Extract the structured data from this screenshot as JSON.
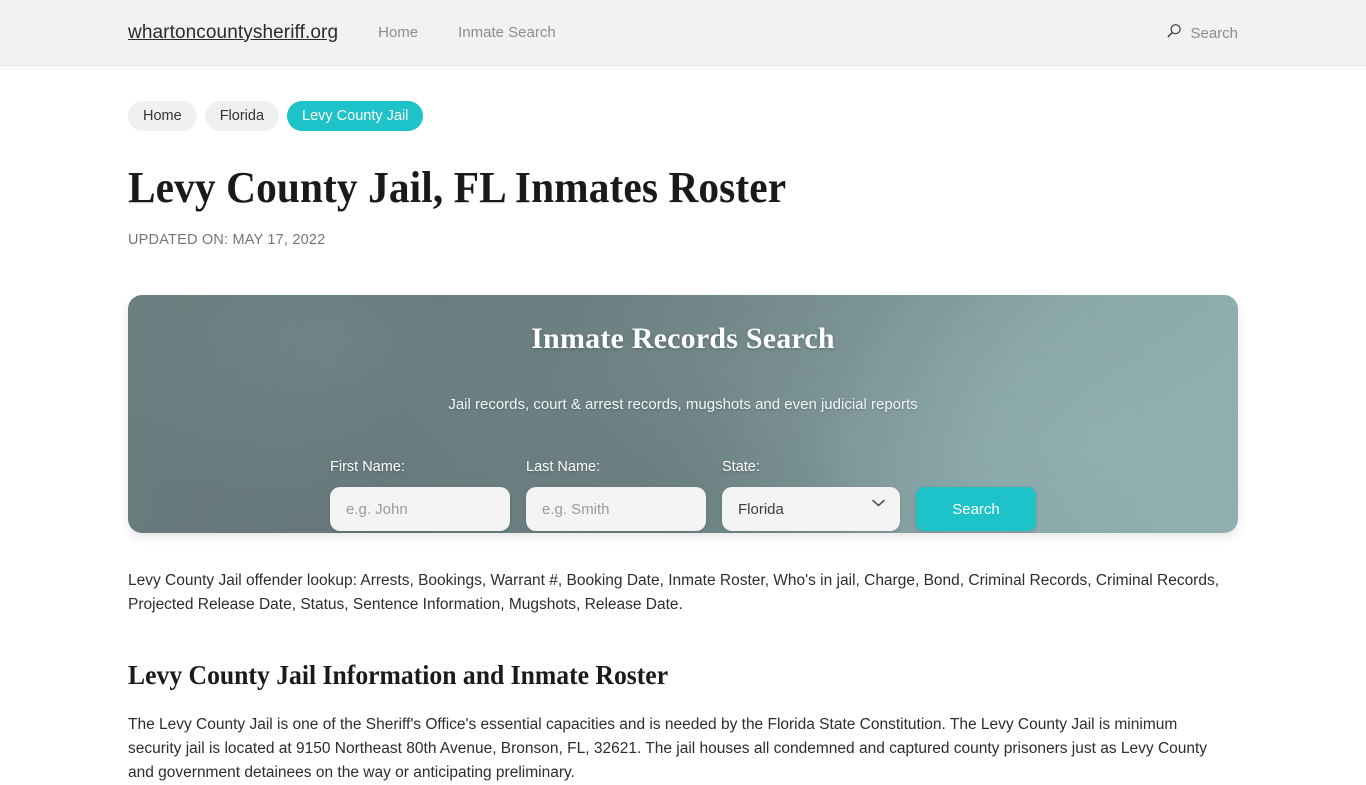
{
  "header": {
    "brand": "whartoncountysheriff.org",
    "nav": [
      {
        "label": "Home"
      },
      {
        "label": "Inmate Search"
      }
    ],
    "search_label": "Search"
  },
  "breadcrumb": {
    "items": [
      {
        "label": "Home",
        "active": false
      },
      {
        "label": "Florida",
        "active": false
      },
      {
        "label": "Levy County Jail",
        "active": true
      }
    ]
  },
  "main": {
    "title": "Levy County Jail, FL Inmates Roster",
    "updated_on": "UPDATED ON: MAY 17, 2022",
    "lede": "Levy County Jail offender lookup: Arrests, Bookings, Warrant #, Booking Date, Inmate Roster, Who's in jail, Charge, Bond, Criminal Records, Criminal Records, Projected Release Date, Status, Sentence Information, Mugshots, Release Date.",
    "section_heading": "Levy County Jail Information and Inmate Roster",
    "body_copy": "The Levy County Jail is one of the Sheriff's Office's essential capacities and is needed by the Florida State Constitution. The Levy County Jail is minimum security jail is located at 9150 Northeast 80th Avenue, Bronson, FL, 32621. The jail houses all condemned and captured county prisoners just as Levy County and government detainees on the way or anticipating preliminary."
  },
  "search_card": {
    "title": "Inmate Records Search",
    "subtitle": "Jail records, court & arrest records, mugshots and even judicial reports",
    "first_name": {
      "label": "First Name:",
      "placeholder": "e.g. John",
      "value": ""
    },
    "last_name": {
      "label": "Last Name:",
      "placeholder": "e.g. Smith",
      "value": ""
    },
    "state": {
      "label": "State:",
      "selected": "Florida"
    },
    "submit_label": "Search"
  },
  "colors": {
    "accent_teal": "#1ec2c9",
    "header_bg": "#f2f2f2",
    "card_gradient_start": "#6a7d7d",
    "card_gradient_end": "#90aeb0",
    "crumb_bg": "#f0f0f0",
    "muted_text": "#8d8d8d"
  },
  "icons": {
    "search": "search-icon",
    "chevron_down": "chevron-down-icon"
  }
}
